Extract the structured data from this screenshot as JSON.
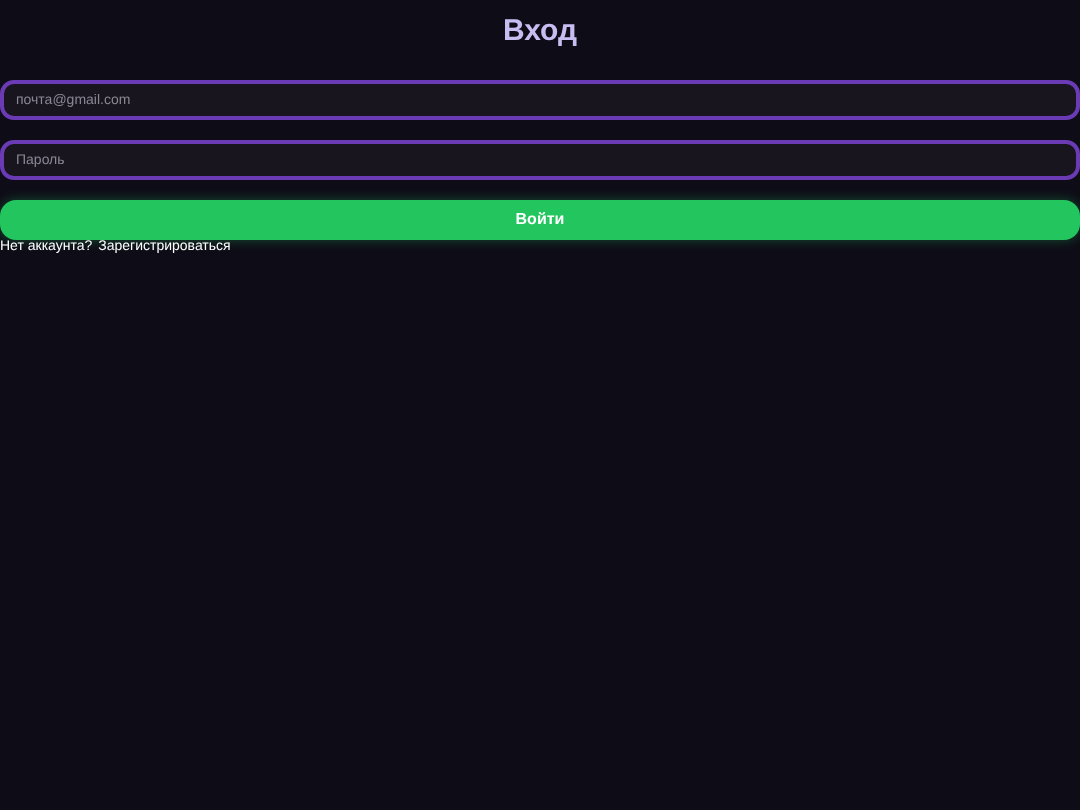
{
  "title": "Вход",
  "fields": [
    {
      "placeholder": "почта@gmail.com"
    },
    {
      "placeholder": "Пароль"
    }
  ],
  "button": "Войти",
  "footer": {
    "text": "Нет аккаунта?",
    "link": "Зарегистрироваться"
  }
}
